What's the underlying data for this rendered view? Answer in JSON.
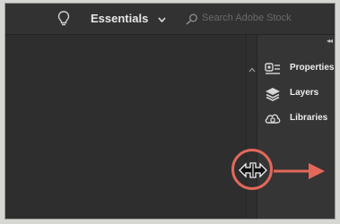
{
  "toolbar": {
    "workspace_label": "Essentials",
    "search_placeholder": "Search Adobe Stock"
  },
  "dock": {
    "items": [
      {
        "label": "Properties",
        "icon": "properties-icon"
      },
      {
        "label": "Layers",
        "icon": "layers-icon"
      },
      {
        "label": "Libraries",
        "icon": "libraries-icon"
      }
    ]
  },
  "icons": [
    "lightbulb-icon",
    "chevron-down-icon",
    "search-icon",
    "chevron-up-icon",
    "double-chevron-icon",
    "resize-horizontal-icon",
    "arrow-right-icon"
  ],
  "colors": {
    "ui_dark": "#2e2e2e",
    "panel": "#353535",
    "text": "#ececec",
    "highlight": "#e3685a"
  }
}
